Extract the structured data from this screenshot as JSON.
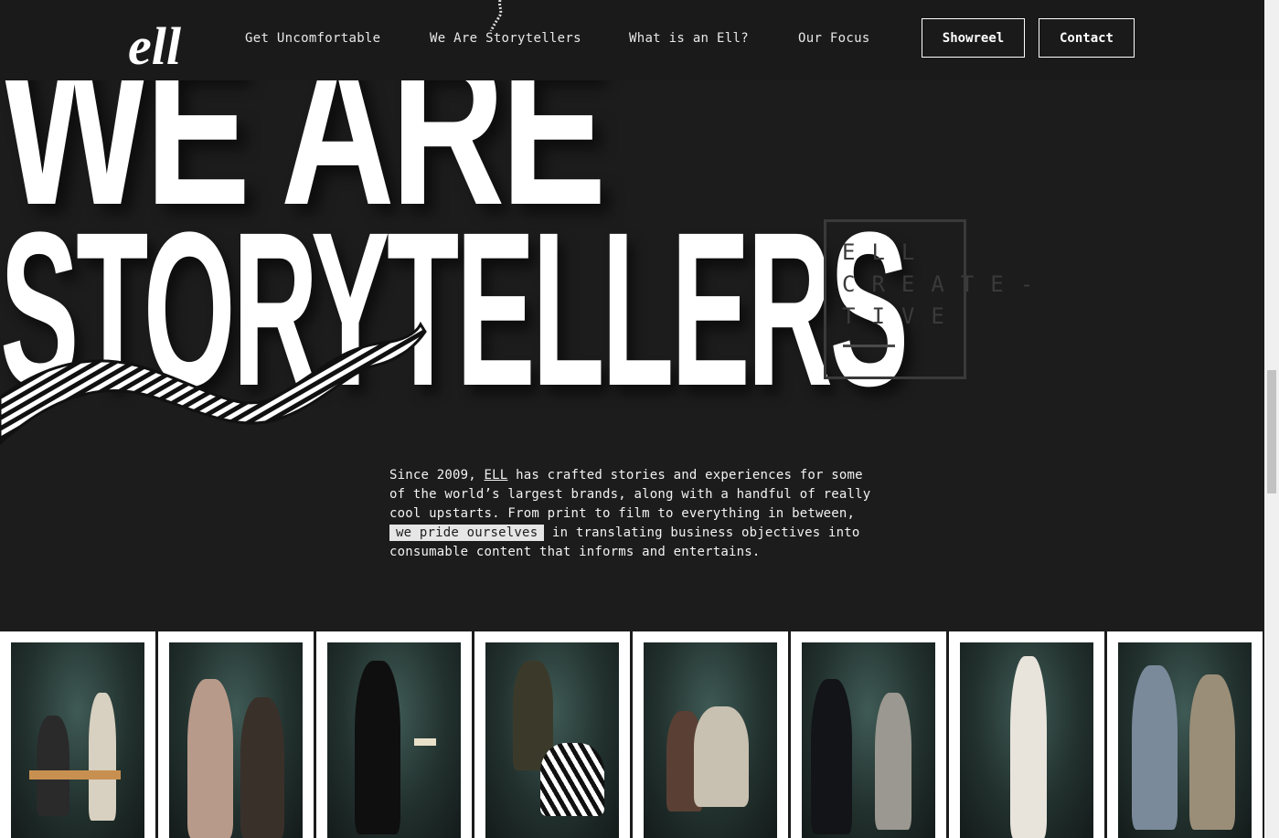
{
  "header": {
    "logo_text": "ell",
    "nav": [
      {
        "label": "Get Uncomfortable"
      },
      {
        "label": "We Are Storytellers"
      },
      {
        "label": "What is an Ell?"
      },
      {
        "label": "Our Focus"
      }
    ],
    "showreel_label": "Showreel",
    "contact_label": "Contact"
  },
  "hero": {
    "line1": "WE ARE",
    "line2": "STORYTELLERS"
  },
  "box_logo": {
    "line1": "ELL",
    "line2": "CREATE-",
    "line3": "TIVE"
  },
  "intro": {
    "part1": "Since 2009, ",
    "link": "ELL",
    "part2": " has crafted stories and experiences for some of the world’s largest brands, along with a handful of really cool upstarts. From print to film to everything in between, ",
    "highlight": "we pride ourselves",
    "part3": " in translating business objectives into consumable content that informs and entertains."
  },
  "colors": {
    "background": "#1c1c1c",
    "header": "#1a1a1a",
    "text": "#ffffff",
    "highlight_bg": "#e6e6e6"
  },
  "gallery": {
    "count": 8
  }
}
